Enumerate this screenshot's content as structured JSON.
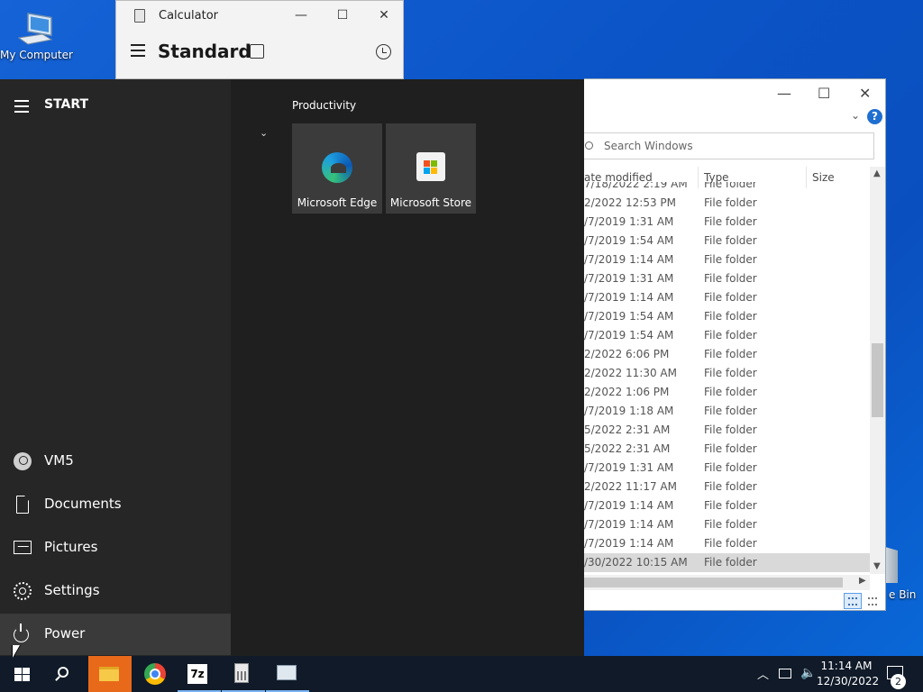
{
  "desktop": {
    "my_computer_label": "My Computer",
    "recycle_bin_label": "e Bin"
  },
  "calculator": {
    "title": "Calculator",
    "mode": "Standard",
    "minimize": "—",
    "maximize": "☐",
    "close": "✕"
  },
  "explorer": {
    "search_placeholder": "Search Windows",
    "columns": {
      "date": "ate modified",
      "type": "Type",
      "size": "Size"
    },
    "rows": [
      {
        "date": "7/18/2022 2:19 AM",
        "type": "File folder"
      },
      {
        "date": "2/2022 12:53 PM",
        "type": "File folder"
      },
      {
        "date": "/7/2019 1:31 AM",
        "type": "File folder"
      },
      {
        "date": "/7/2019 1:54 AM",
        "type": "File folder"
      },
      {
        "date": "/7/2019 1:14 AM",
        "type": "File folder"
      },
      {
        "date": "/7/2019 1:31 AM",
        "type": "File folder"
      },
      {
        "date": "/7/2019 1:14 AM",
        "type": "File folder"
      },
      {
        "date": "/7/2019 1:54 AM",
        "type": "File folder"
      },
      {
        "date": "/7/2019 1:54 AM",
        "type": "File folder"
      },
      {
        "date": "2/2022 6:06 PM",
        "type": "File folder"
      },
      {
        "date": "2/2022 11:30 AM",
        "type": "File folder"
      },
      {
        "date": "2/2022 1:06 PM",
        "type": "File folder"
      },
      {
        "date": "/7/2019 1:18 AM",
        "type": "File folder"
      },
      {
        "date": "5/2022 2:31 AM",
        "type": "File folder"
      },
      {
        "date": "5/2022 2:31 AM",
        "type": "File folder"
      },
      {
        "date": "/7/2019 1:31 AM",
        "type": "File folder"
      },
      {
        "date": "2/2022 11:17 AM",
        "type": "File folder"
      },
      {
        "date": "/7/2019 1:14 AM",
        "type": "File folder"
      },
      {
        "date": "/7/2019 1:14 AM",
        "type": "File folder"
      },
      {
        "date": "/7/2019 1:14 AM",
        "type": "File folder"
      },
      {
        "date": "/30/2022 10:15 AM",
        "type": "File folder"
      }
    ],
    "help": "?"
  },
  "start_menu": {
    "header": "START",
    "user": "VM5",
    "documents": "Documents",
    "pictures": "Pictures",
    "settings": "Settings",
    "power": "Power",
    "group_label": "Productivity",
    "tiles": [
      {
        "label": "Microsoft Edge"
      },
      {
        "label": "Microsoft Store"
      }
    ]
  },
  "taskbar": {
    "sevenzip_label": "7z",
    "clock_time": "11:14 AM",
    "clock_date": "12/30/2022",
    "notification_count": "2"
  },
  "colors": {
    "accent": "#e8691a",
    "desktop": "#0b55c8",
    "start_left": "#262626",
    "start_right": "#1f1f1f",
    "taskbar": "#101a28"
  }
}
